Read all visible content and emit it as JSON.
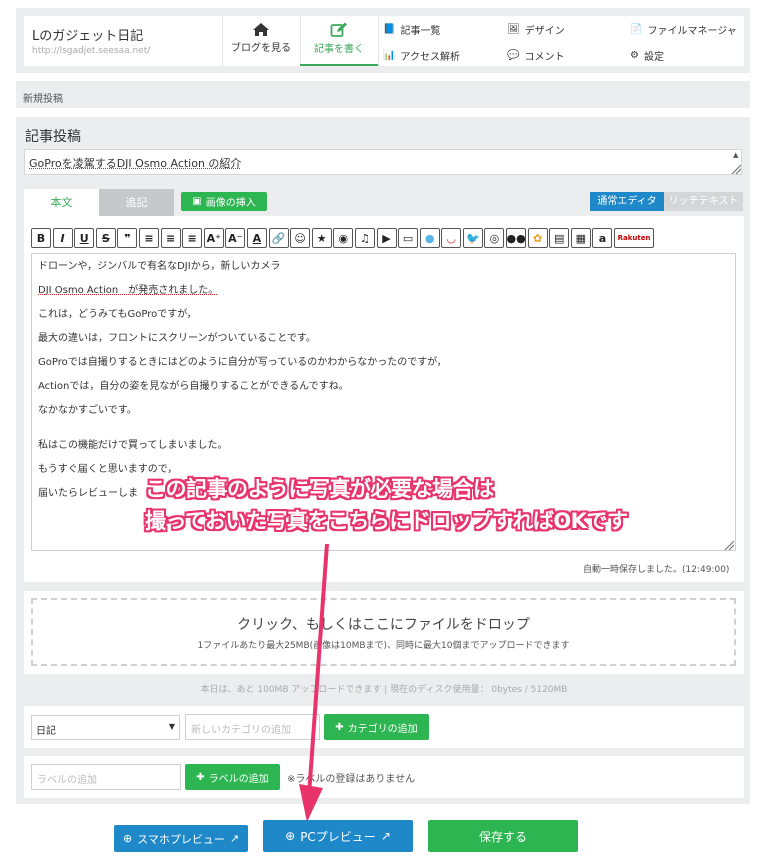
{
  "header": {
    "blog_title": "Lのガジェット日記",
    "blog_url": "http://lsgadjet.seesaa.net/",
    "nav_view": "ブログを見る",
    "nav_write": "記事を書く",
    "menu": [
      "記事一覧",
      "デザイン",
      "ファイルマネージャ",
      "アクセス解析",
      "コメント",
      "設定"
    ]
  },
  "breadcrumb": "新規投稿",
  "post": {
    "section_title": "記事投稿",
    "title_value": "GoProを凌駕するDJI Osmo Action の紹介",
    "tab_body": "本文",
    "tab_extra": "追記",
    "insert_image": "画像の挿入",
    "editor_normal": "通常エディタ",
    "editor_rich": "リッチテキスト",
    "body_lines": [
      "ドローンや，ジンバルで有名なDJIから，新しいカメラ",
      "DJI Osmo Action　が発売されました。",
      "これは，どうみてもGoProですが，",
      "最大の違いは，フロントにスクリーンがついていることです。",
      "GoProでは自撮りするときにはどのように自分が写っているのかわからなかったのですが，",
      "Actionでは，自分の姿を見ながら自撮りすることができるんですね。",
      "なかなかすごいです。",
      "私はこの機能だけで買ってしまいました。",
      "もうすぐ届くと思いますので，",
      "届いたらレビューしま"
    ],
    "autosave": "自動一時保存しました。(12:49:00)"
  },
  "upload": {
    "drop_main": "クリック、もしくはここにファイルをドロップ",
    "drop_sub": "1ファイルあたり最大25MB(画像は10MBまで)、同時に最大10個までアップロードできます",
    "quota": "本日は、あと 100MB アップロードできます  |  現在のディスク使用量： 0bytes / 5120MB"
  },
  "category": {
    "selected": "日記",
    "new_placeholder": "新しいカテゴリの追加",
    "add_label": "カテゴリの追加"
  },
  "label": {
    "placeholder": "ラベルの追加",
    "add_label": "ラベルの追加",
    "note": "※ラベルの登録はありません"
  },
  "actions": {
    "sp_preview": "スマホプレビュー",
    "pc_preview": "PCプレビュー",
    "save": "保存する"
  },
  "annotation": {
    "line1": "この記事のように写真が必要な場合は",
    "line2": "撮っておいた写真をこちらにドロップすればOKです"
  },
  "colors": {
    "accent_green": "#2db552",
    "accent_blue": "#1e88c8",
    "annotation_pink": "#e8336b"
  }
}
